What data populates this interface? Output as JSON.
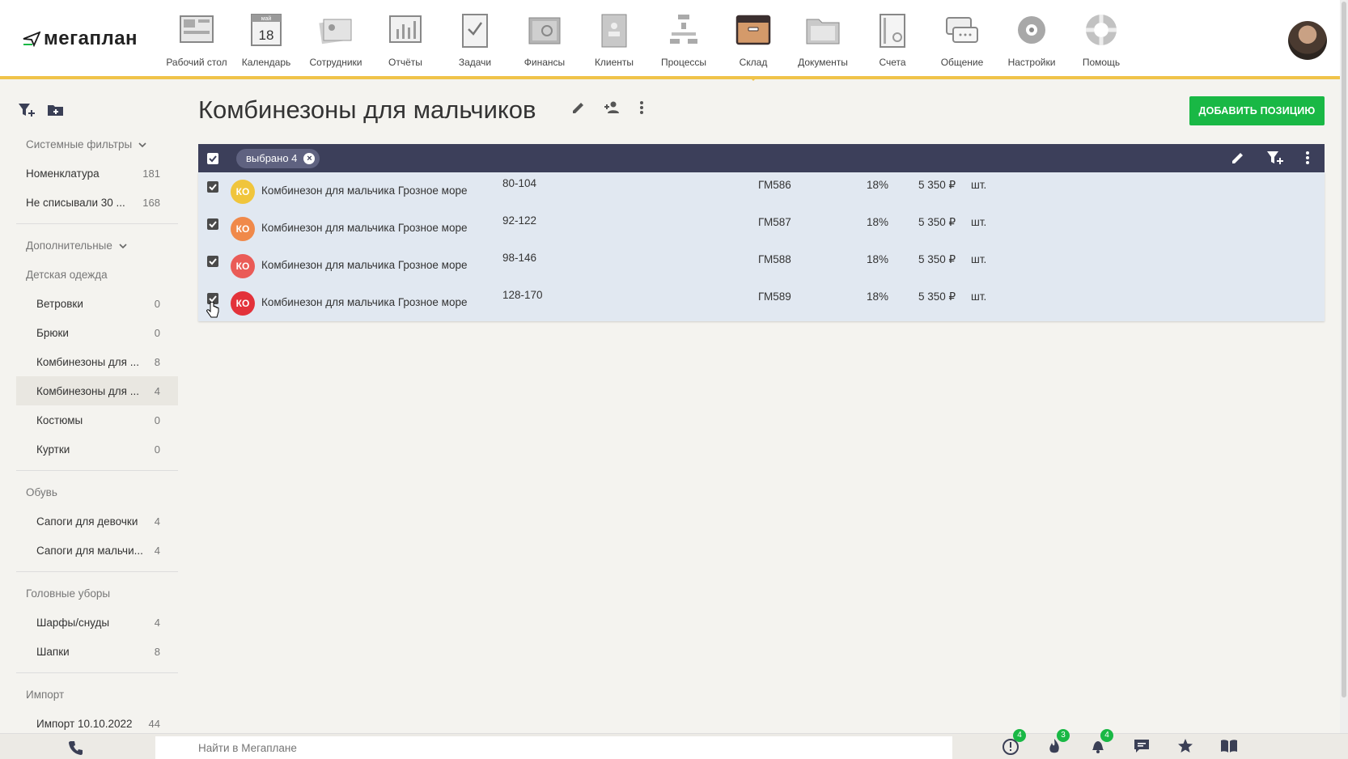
{
  "app": {
    "logo": "мегаплан"
  },
  "nav": [
    {
      "label": "Рабочий стол",
      "icon": "desktop-icon"
    },
    {
      "label": "Календарь",
      "icon": "calendar-icon",
      "cal_month": "май",
      "cal_day": "18"
    },
    {
      "label": "Сотрудники",
      "icon": "employees-icon"
    },
    {
      "label": "Отчёты",
      "icon": "reports-icon"
    },
    {
      "label": "Задачи",
      "icon": "tasks-icon"
    },
    {
      "label": "Финансы",
      "icon": "safe-icon"
    },
    {
      "label": "Клиенты",
      "icon": "clients-icon"
    },
    {
      "label": "Процессы",
      "icon": "processes-icon"
    },
    {
      "label": "Склад",
      "icon": "warehouse-box-icon",
      "active": true
    },
    {
      "label": "Документы",
      "icon": "documents-folder-icon"
    },
    {
      "label": "Счета",
      "icon": "invoice-icon"
    },
    {
      "label": "Общение",
      "icon": "chat-icon"
    },
    {
      "label": "Настройки",
      "icon": "gear-icon"
    },
    {
      "label": "Помощь",
      "icon": "lifebuoy-icon"
    }
  ],
  "sidebar": {
    "system_filters": "Системные фильтры",
    "system_items": [
      {
        "name": "Номенклатура",
        "count": "181"
      },
      {
        "name": "Не списывали 30 ...",
        "count": "168"
      }
    ],
    "additional": "Дополнительные",
    "groups": [
      {
        "title": "Детская одежда",
        "items": [
          {
            "name": "Ветровки",
            "count": "0"
          },
          {
            "name": "Брюки",
            "count": "0"
          },
          {
            "name": "Комбинезоны для ...",
            "count": "8"
          },
          {
            "name": "Комбинезоны для ...",
            "count": "4",
            "selected": true
          },
          {
            "name": "Костюмы",
            "count": "0"
          },
          {
            "name": "Куртки",
            "count": "0"
          }
        ]
      },
      {
        "title": "Обувь",
        "items": [
          {
            "name": "Сапоги для девочки",
            "count": "4"
          },
          {
            "name": "Сапоги для мальчи...",
            "count": "4"
          }
        ]
      },
      {
        "title": "Головные уборы",
        "items": [
          {
            "name": "Шарфы/снуды",
            "count": "4"
          },
          {
            "name": "Шапки",
            "count": "8"
          }
        ]
      },
      {
        "title": "Импорт",
        "items": [
          {
            "name": "Импорт 10.10.2022",
            "count": "44"
          }
        ]
      }
    ]
  },
  "header": {
    "title": "Комбинезоны для мальчиков",
    "add_button": "ДОБАВИТЬ ПОЗИЦИЮ"
  },
  "selection": {
    "label": "выбрано 4"
  },
  "rows": [
    {
      "initials": "КО",
      "color": "#f0c53c",
      "name": "Комбинезон для мальчика Грозное море",
      "size": "80-104",
      "article": "ГМ586",
      "vat": "18%",
      "price": "5 350 ₽",
      "unit": "шт."
    },
    {
      "initials": "КО",
      "color": "#f0894a",
      "name": "Комбинезон для мальчика Грозное море",
      "size": "92-122",
      "article": "ГМ587",
      "vat": "18%",
      "price": "5 350 ₽",
      "unit": "шт."
    },
    {
      "initials": "КО",
      "color": "#ea5b57",
      "name": "Комбинезон для мальчика Грозное море",
      "size": "98-146",
      "article": "ГМ588",
      "vat": "18%",
      "price": "5 350 ₽",
      "unit": "шт."
    },
    {
      "initials": "КО",
      "color": "#e3323a",
      "name": "Комбинезон для мальчика Грозное море",
      "size": "128-170",
      "article": "ГМ589",
      "vat": "18%",
      "price": "5 350 ₽",
      "unit": "шт."
    }
  ],
  "footer": {
    "search_placeholder": "Найти в Мегаплане",
    "icons": [
      {
        "name": "alert-icon",
        "badge": "4"
      },
      {
        "name": "fire-icon",
        "badge": "3"
      },
      {
        "name": "bell-icon",
        "badge": "4"
      },
      {
        "name": "message-icon"
      },
      {
        "name": "star-icon"
      },
      {
        "name": "book-icon"
      }
    ]
  },
  "colors": {
    "accent_yellow": "#f0c34a",
    "green": "#19b845",
    "selection_bar": "#3c3f5a",
    "row_selected": "#e1e8f1"
  }
}
